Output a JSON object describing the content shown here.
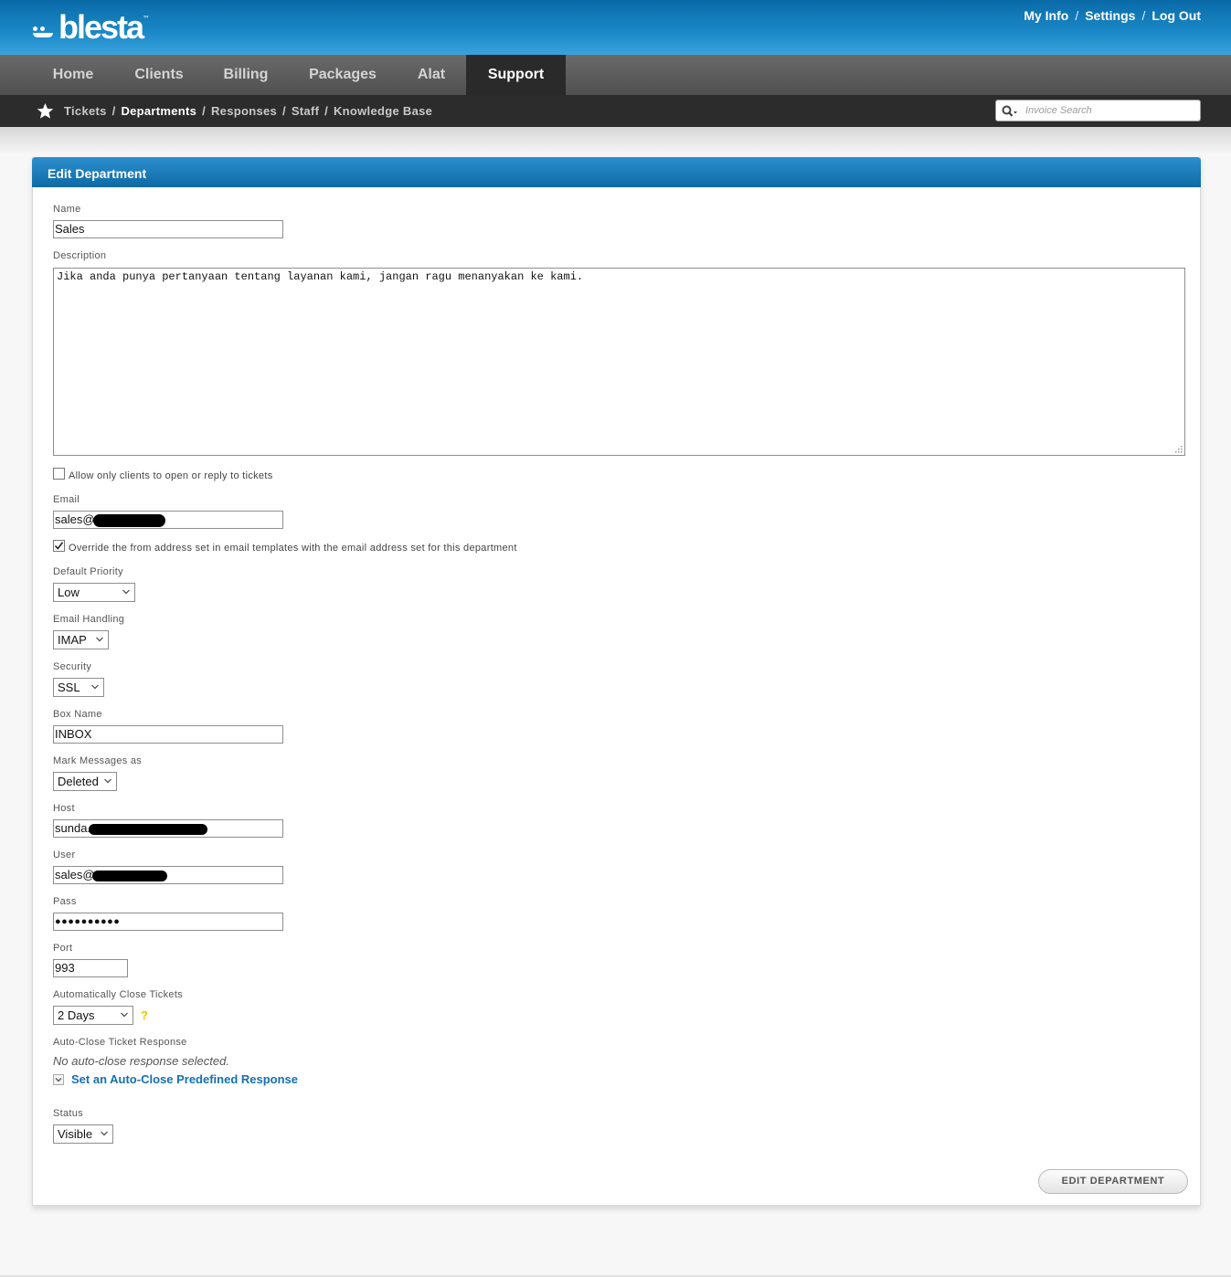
{
  "header": {
    "logo_text": "blesta",
    "logo_tm": "™",
    "links": [
      {
        "label": "My Info"
      },
      {
        "label": "Settings"
      },
      {
        "label": "Log Out"
      }
    ],
    "separator": "/"
  },
  "nav": {
    "items": [
      {
        "label": "Home"
      },
      {
        "label": "Clients"
      },
      {
        "label": "Billing"
      },
      {
        "label": "Packages"
      },
      {
        "label": "Alat"
      },
      {
        "label": "Support"
      }
    ],
    "active": "Support"
  },
  "subnav": {
    "items": [
      {
        "label": "Tickets"
      },
      {
        "label": "Departments"
      },
      {
        "label": "Responses"
      },
      {
        "label": "Staff"
      },
      {
        "label": "Knowledge Base"
      }
    ],
    "active": "Departments",
    "search_placeholder": "Invoice Search"
  },
  "panel": {
    "title": "Edit Department"
  },
  "form": {
    "name": {
      "label": "Name",
      "value": "Sales"
    },
    "description": {
      "label": "Description",
      "value": "Jika anda punya pertanyaan tentang layanan kami, jangan ragu menanyakan ke kami."
    },
    "clients_only": {
      "label": "Allow only clients to open or reply to tickets",
      "checked": false
    },
    "email": {
      "label": "Email",
      "value": "sales@",
      "redacted": true
    },
    "override_from": {
      "label": "Override the from address set in email templates with the email address set for this department",
      "checked": true
    },
    "default_priority": {
      "label": "Default Priority",
      "value": "Low"
    },
    "email_handling": {
      "label": "Email Handling",
      "value": "IMAP"
    },
    "security": {
      "label": "Security",
      "value": "SSL"
    },
    "box_name": {
      "label": "Box Name",
      "value": "INBOX"
    },
    "mark_messages": {
      "label": "Mark Messages as",
      "value": "Deleted"
    },
    "host": {
      "label": "Host",
      "value": "sunda.",
      "redacted": true
    },
    "user": {
      "label": "User",
      "value": "sales@",
      "redacted": true
    },
    "pass": {
      "label": "Pass",
      "value": "●●●●●●●●●●"
    },
    "port": {
      "label": "Port",
      "value": "993"
    },
    "auto_close": {
      "label": "Automatically Close Tickets",
      "value": "2 Days",
      "help": "?"
    },
    "auto_close_response": {
      "label": "Auto-Close Ticket Response",
      "note": "No auto-close response selected.",
      "link": "Set an Auto-Close Predefined Response"
    },
    "status": {
      "label": "Status",
      "value": "Visible"
    },
    "submit_label": "EDIT DEPARTMENT"
  },
  "colors": {
    "header_blue": "#1b89c8",
    "nav_gray": "#5a5a5a",
    "subnav_dark": "#2c2c2c",
    "link_blue": "#1470b0",
    "help_yellow": "#e8c300"
  }
}
